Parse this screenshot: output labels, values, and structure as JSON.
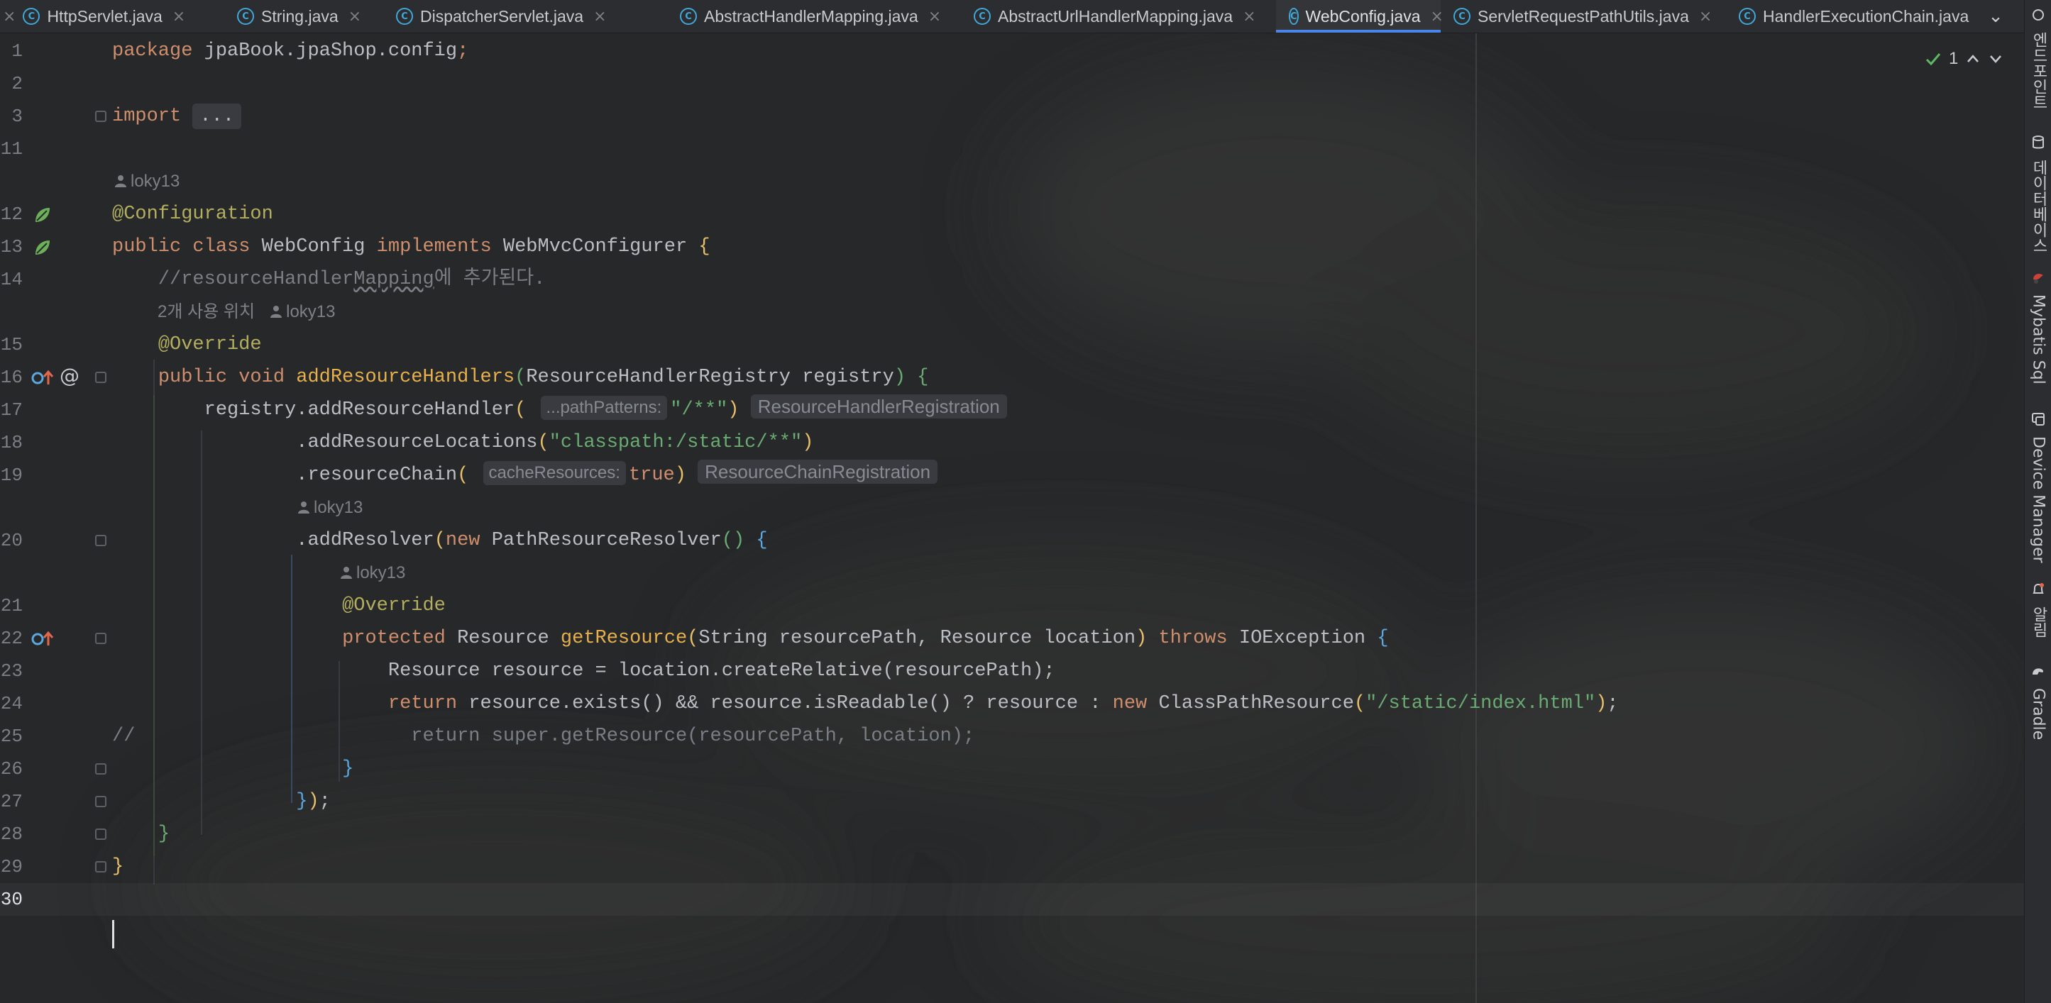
{
  "tabs": [
    {
      "label": "HttpServlet.java",
      "active": false,
      "icon": "servlet-class-icon"
    },
    {
      "label": "String.java",
      "active": false,
      "icon": "class-icon"
    },
    {
      "label": "DispatcherServlet.java",
      "active": false,
      "icon": "class-icon"
    },
    {
      "label": "AbstractHandlerMapping.java",
      "active": false,
      "icon": "abstract-class-icon"
    },
    {
      "label": "AbstractUrlHandlerMapping.java",
      "active": false,
      "icon": "abstract-class-icon"
    },
    {
      "label": "WebConfig.java",
      "active": true,
      "icon": "class-icon"
    },
    {
      "label": "ServletRequestPathUtils.java",
      "active": false,
      "icon": "abstract-class-icon"
    },
    {
      "label": "HandlerExecutionChain.java",
      "active": false,
      "icon": "class-icon"
    }
  ],
  "inspections": {
    "count": "1"
  },
  "line_numbers": [
    "1",
    "2",
    "3",
    "11",
    "12",
    "13",
    "14",
    "15",
    "16",
    "17",
    "18",
    "19",
    "20",
    "21",
    "22",
    "23",
    "24",
    "25",
    "26",
    "27",
    "28",
    "29",
    "30"
  ],
  "code": {
    "package_kw": "package",
    "package_name": "jpaBook.jpaShop.config",
    "semi": ";",
    "import_kw": "import",
    "import_folded": "...",
    "author": "loky13",
    "configuration_ann": "@Configuration",
    "public": "public",
    "class": "class",
    "class_name": "WebConfig",
    "implements": "implements",
    "iface": "WebMvcConfigurer",
    "comment_prefix": "//resourceHandler",
    "comment_underlined": "Mapping",
    "comment_suffix": "에 추가된다.",
    "usages": "2개 사용 위치",
    "override": "@Override",
    "void": "void",
    "method_add": "addResourceHandlers",
    "param_type": "ResourceHandlerRegistry",
    "param_name": "registry",
    "registry_call": "registry.addResourceHandler",
    "hint_path": "...pathPatterns:",
    "str_path": "\"/**\"",
    "hint_type1": "ResourceHandlerRegistration",
    "add_locations": ".addResourceLocations",
    "str_locations": "\"classpath:/static/**\"",
    "resource_chain": ".resourceChain",
    "hint_cache": "cacheResources:",
    "true_kw": "true",
    "hint_type2": "ResourceChainRegistration",
    "add_resolver": ".addResolver",
    "new_kw": "new",
    "resolver_class": "PathResourceResolver",
    "protected": "protected",
    "resource_type": "Resource",
    "method_get": "getResource",
    "string_type": "String",
    "rp_param": "resourcePath",
    "loc_param": "location",
    "throws": "throws",
    "ioexc": "IOException",
    "line23": "Resource resource = location.createRelative(resourcePath);",
    "return_kw": "return",
    "line24_mid": "resource.exists() && resource.isReadable() ? resource : ",
    "cpr_class": "ClassPathResource",
    "str_index": "\"/static/index.html\"",
    "line25_comment": "//",
    "line25_rest": "return super.getResource(resourcePath, location);"
  },
  "right_toolbar": [
    {
      "label": "엔드포인트",
      "icon": "endpoints-icon"
    },
    {
      "label": "데이터베이스",
      "icon": "database-icon"
    },
    {
      "label": "Mybatis Sql",
      "icon": "mybatis-icon"
    },
    {
      "label": "Device Manager",
      "icon": "device-manager-icon"
    },
    {
      "label": "알림",
      "icon": "notifications-icon"
    },
    {
      "label": "Gradle",
      "icon": "gradle-icon"
    }
  ],
  "colors": {
    "accent": "#4a86e8",
    "keyword": "#cf8e6d",
    "annotation": "#b3ae60",
    "string": "#6aab73",
    "method_decl": "#e8b04d"
  }
}
